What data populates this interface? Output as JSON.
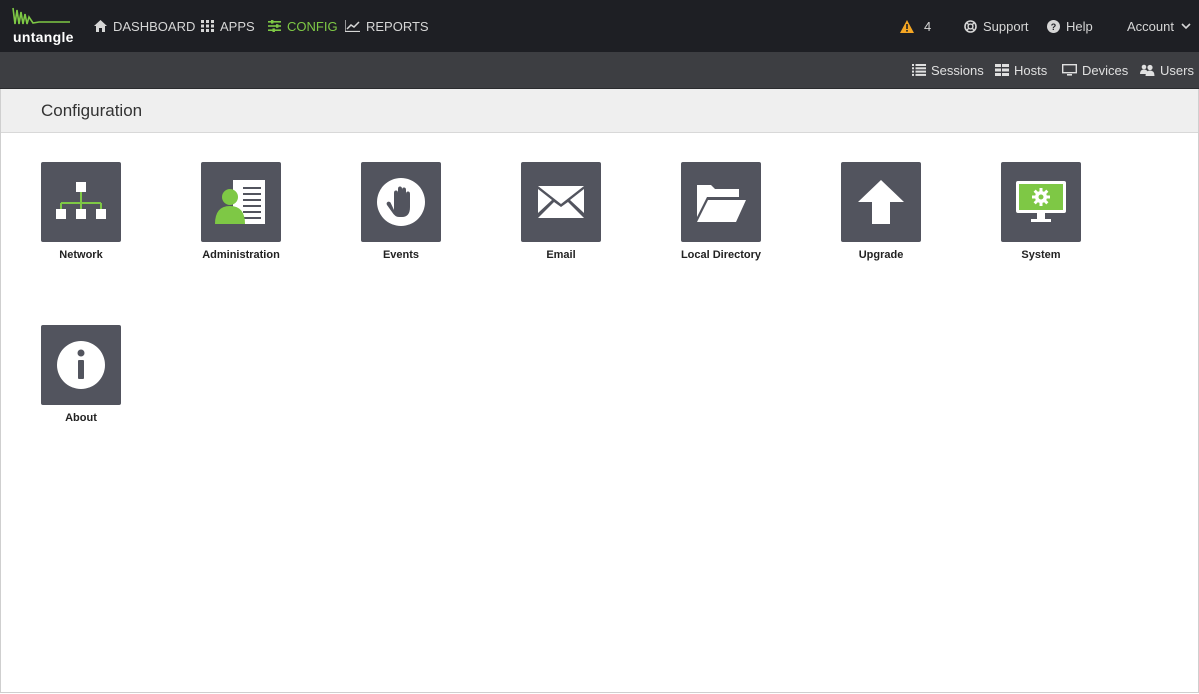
{
  "app": {
    "logo_text": "untangle"
  },
  "nav": {
    "items": [
      {
        "label": "DASHBOARD",
        "icon": "home-icon"
      },
      {
        "label": "APPS",
        "icon": "grid-icon"
      },
      {
        "label": "CONFIG",
        "icon": "sliders-icon",
        "active": true
      },
      {
        "label": "REPORTS",
        "icon": "chart-icon"
      }
    ],
    "alert_count": "4",
    "support_label": "Support",
    "help_label": "Help",
    "account_label": "Account"
  },
  "subnav": {
    "items": [
      {
        "label": "Sessions",
        "icon": "list-icon"
      },
      {
        "label": "Hosts",
        "icon": "table-icon"
      },
      {
        "label": "Devices",
        "icon": "monitor-icon"
      },
      {
        "label": "Users",
        "icon": "users-icon"
      }
    ]
  },
  "page": {
    "title": "Configuration"
  },
  "tiles": [
    {
      "label": "Network",
      "icon": "network-icon"
    },
    {
      "label": "Administration",
      "icon": "admin-icon"
    },
    {
      "label": "Events",
      "icon": "hand-icon"
    },
    {
      "label": "Email",
      "icon": "envelope-icon"
    },
    {
      "label": "Local Directory",
      "icon": "folder-icon"
    },
    {
      "label": "Upgrade",
      "icon": "arrow-up-icon"
    },
    {
      "label": "System",
      "icon": "system-icon"
    },
    {
      "label": "About",
      "icon": "info-icon"
    }
  ],
  "colors": {
    "accent": "#7ec845",
    "topbar": "#1e1f24",
    "subbar": "#3d3e42",
    "tile": "#52545e",
    "warning": "#f5a623"
  }
}
